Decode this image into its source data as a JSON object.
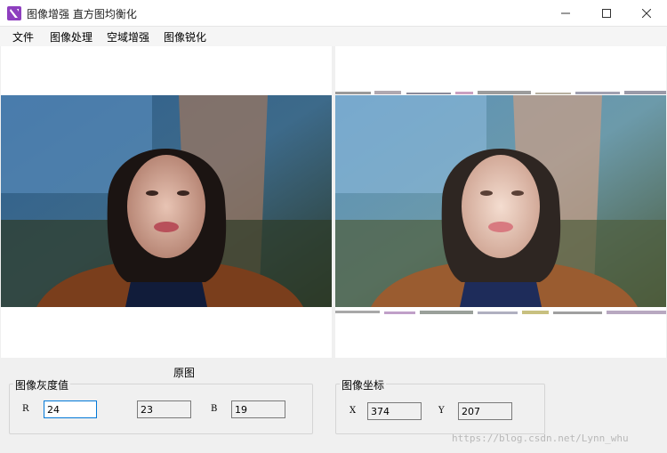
{
  "window": {
    "title": "图像增强 直方图均衡化",
    "app_icon": "app-logo-icon",
    "controls": [
      "minimize-icon",
      "maximize-icon",
      "close-icon"
    ]
  },
  "menu": {
    "items": [
      {
        "label": "文件"
      },
      {
        "label": "图像处理"
      },
      {
        "label": "空域增强"
      },
      {
        "label": "图像锐化"
      }
    ]
  },
  "images": {
    "left_caption": "原图"
  },
  "gray_group": {
    "title": "图像灰度值",
    "r_label": "R",
    "r_value": "24",
    "g_value": "23",
    "b_label": "B",
    "b_value": "19"
  },
  "coord_group": {
    "title": "图像坐标",
    "x_label": "X",
    "x_value": "374",
    "y_label": "Y",
    "y_value": "207"
  },
  "watermark": "https://blog.csdn.net/Lynn_whu",
  "colors": {
    "accent": "#8e3fbf",
    "focus_border": "#0078d7",
    "background": "#f0f0f0"
  }
}
